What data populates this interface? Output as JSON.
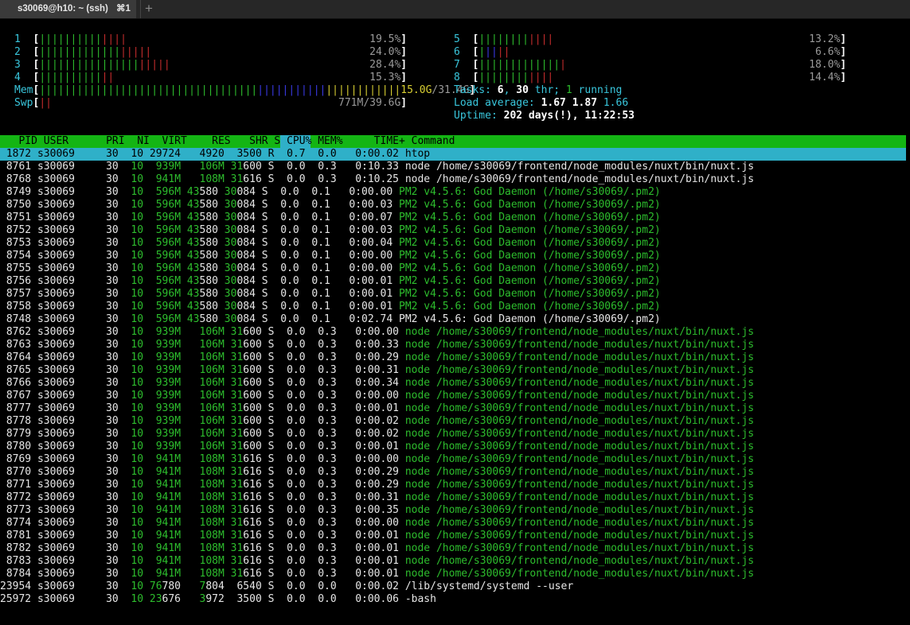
{
  "window": {
    "tab_title": "s30069@h10: ~ (ssh)",
    "tab_shortcut": "⌘1",
    "new_tab_label": "+"
  },
  "colors": {
    "background": "#000000",
    "header_bar": "#14b514",
    "selected_row": "#2fb0c8",
    "meter_green": "#2dbd2d",
    "meter_red": "#c42c2c",
    "meter_blue": "#3a3ae6",
    "meter_yellow": "#d8cf32",
    "label_cyan": "#39c6dc"
  },
  "cpu_meters": [
    {
      "id": "1",
      "percent": "19.5%",
      "green_bars": 10,
      "red_bars": 4
    },
    {
      "id": "2",
      "percent": "24.0%",
      "green_bars": 13,
      "red_bars": 5
    },
    {
      "id": "3",
      "percent": "28.4%",
      "green_bars": 16,
      "red_bars": 5
    },
    {
      "id": "4",
      "percent": "15.3%",
      "green_bars": 10,
      "red_bars": 2
    },
    {
      "id": "5",
      "percent": "13.2%",
      "green_bars": 8,
      "red_bars": 4
    },
    {
      "id": "6",
      "percent": "6.6%",
      "green_bars": 1,
      "blue_bars": 2,
      "red_bars": 2
    },
    {
      "id": "7",
      "percent": "18.0%",
      "green_bars": 13,
      "red_bars": 1
    },
    {
      "id": "8",
      "percent": "14.4%",
      "green_bars": 8,
      "red_bars": 4
    }
  ],
  "mem": {
    "label": "Mem",
    "used": "15.0G",
    "total": "31.4G",
    "green_bars": 35,
    "blue_bars": 11,
    "yellow_bars": 12
  },
  "swap": {
    "label": "Swp",
    "used": "771M",
    "total": "39.6G",
    "red_bars": 2
  },
  "tasks": {
    "label": "Tasks: ",
    "count": "6",
    "sep": ", ",
    "threads": "30",
    "thr_label": " thr; ",
    "running": "1",
    "running_label": " running"
  },
  "load": {
    "label": "Load average: ",
    "one": "1.67",
    "five": "1.87",
    "fifteen": "1.66"
  },
  "uptime": {
    "label": "Uptime: ",
    "value": "202 days(!), 11:22:53"
  },
  "columns": [
    "PID",
    "USER",
    "PRI",
    "NI",
    "VIRT",
    "RES",
    "SHR",
    "S",
    "CPU%",
    "MEM%",
    "TIME+",
    "Command"
  ],
  "processes": [
    {
      "pid": "1872",
      "user": "s30069",
      "pri": "30",
      "ni": "10",
      "virt": "29724",
      "res": "4920",
      "shr": "3500",
      "s": "R",
      "cpu": "0.7",
      "mem": "0.0",
      "time": "0:00.02",
      "cmd": "htop",
      "thread": false,
      "selected": true
    },
    {
      "pid": "8761",
      "user": "s30069",
      "pri": "30",
      "ni": "10",
      "virt": "939M",
      "res": "106M",
      "shr": "31600",
      "s": "S",
      "cpu": "0.0",
      "mem": "0.3",
      "time": "0:10.33",
      "cmd": "node /home/s30069/frontend/node_modules/nuxt/bin/nuxt.js",
      "thread": false
    },
    {
      "pid": "8768",
      "user": "s30069",
      "pri": "30",
      "ni": "10",
      "virt": "941M",
      "res": "108M",
      "shr": "31616",
      "s": "S",
      "cpu": "0.0",
      "mem": "0.3",
      "time": "0:10.25",
      "cmd": "node /home/s30069/frontend/node_modules/nuxt/bin/nuxt.js",
      "thread": false
    },
    {
      "pid": "8749",
      "user": "s30069",
      "pri": "30",
      "ni": "10",
      "virt": "596M",
      "res": "43580",
      "shr": "30084",
      "s": "S",
      "cpu": "0.0",
      "mem": "0.1",
      "time": "0:00.00",
      "cmd": "PM2 v4.5.6: God Daemon (/home/s30069/.pm2)",
      "thread": true
    },
    {
      "pid": "8750",
      "user": "s30069",
      "pri": "30",
      "ni": "10",
      "virt": "596M",
      "res": "43580",
      "shr": "30084",
      "s": "S",
      "cpu": "0.0",
      "mem": "0.1",
      "time": "0:00.03",
      "cmd": "PM2 v4.5.6: God Daemon (/home/s30069/.pm2)",
      "thread": true
    },
    {
      "pid": "8751",
      "user": "s30069",
      "pri": "30",
      "ni": "10",
      "virt": "596M",
      "res": "43580",
      "shr": "30084",
      "s": "S",
      "cpu": "0.0",
      "mem": "0.1",
      "time": "0:00.07",
      "cmd": "PM2 v4.5.6: God Daemon (/home/s30069/.pm2)",
      "thread": true
    },
    {
      "pid": "8752",
      "user": "s30069",
      "pri": "30",
      "ni": "10",
      "virt": "596M",
      "res": "43580",
      "shr": "30084",
      "s": "S",
      "cpu": "0.0",
      "mem": "0.1",
      "time": "0:00.03",
      "cmd": "PM2 v4.5.6: God Daemon (/home/s30069/.pm2)",
      "thread": true
    },
    {
      "pid": "8753",
      "user": "s30069",
      "pri": "30",
      "ni": "10",
      "virt": "596M",
      "res": "43580",
      "shr": "30084",
      "s": "S",
      "cpu": "0.0",
      "mem": "0.1",
      "time": "0:00.04",
      "cmd": "PM2 v4.5.6: God Daemon (/home/s30069/.pm2)",
      "thread": true
    },
    {
      "pid": "8754",
      "user": "s30069",
      "pri": "30",
      "ni": "10",
      "virt": "596M",
      "res": "43580",
      "shr": "30084",
      "s": "S",
      "cpu": "0.0",
      "mem": "0.1",
      "time": "0:00.00",
      "cmd": "PM2 v4.5.6: God Daemon (/home/s30069/.pm2)",
      "thread": true
    },
    {
      "pid": "8755",
      "user": "s30069",
      "pri": "30",
      "ni": "10",
      "virt": "596M",
      "res": "43580",
      "shr": "30084",
      "s": "S",
      "cpu": "0.0",
      "mem": "0.1",
      "time": "0:00.00",
      "cmd": "PM2 v4.5.6: God Daemon (/home/s30069/.pm2)",
      "thread": true
    },
    {
      "pid": "8756",
      "user": "s30069",
      "pri": "30",
      "ni": "10",
      "virt": "596M",
      "res": "43580",
      "shr": "30084",
      "s": "S",
      "cpu": "0.0",
      "mem": "0.1",
      "time": "0:00.01",
      "cmd": "PM2 v4.5.6: God Daemon (/home/s30069/.pm2)",
      "thread": true
    },
    {
      "pid": "8757",
      "user": "s30069",
      "pri": "30",
      "ni": "10",
      "virt": "596M",
      "res": "43580",
      "shr": "30084",
      "s": "S",
      "cpu": "0.0",
      "mem": "0.1",
      "time": "0:00.01",
      "cmd": "PM2 v4.5.6: God Daemon (/home/s30069/.pm2)",
      "thread": true
    },
    {
      "pid": "8758",
      "user": "s30069",
      "pri": "30",
      "ni": "10",
      "virt": "596M",
      "res": "43580",
      "shr": "30084",
      "s": "S",
      "cpu": "0.0",
      "mem": "0.1",
      "time": "0:00.01",
      "cmd": "PM2 v4.5.6: God Daemon (/home/s30069/.pm2)",
      "thread": true
    },
    {
      "pid": "8748",
      "user": "s30069",
      "pri": "30",
      "ni": "10",
      "virt": "596M",
      "res": "43580",
      "shr": "30084",
      "s": "S",
      "cpu": "0.0",
      "mem": "0.1",
      "time": "0:02.74",
      "cmd": "PM2 v4.5.6: God Daemon (/home/s30069/.pm2)",
      "thread": false
    },
    {
      "pid": "8762",
      "user": "s30069",
      "pri": "30",
      "ni": "10",
      "virt": "939M",
      "res": "106M",
      "shr": "31600",
      "s": "S",
      "cpu": "0.0",
      "mem": "0.3",
      "time": "0:00.00",
      "cmd": "node /home/s30069/frontend/node_modules/nuxt/bin/nuxt.js",
      "thread": true
    },
    {
      "pid": "8763",
      "user": "s30069",
      "pri": "30",
      "ni": "10",
      "virt": "939M",
      "res": "106M",
      "shr": "31600",
      "s": "S",
      "cpu": "0.0",
      "mem": "0.3",
      "time": "0:00.33",
      "cmd": "node /home/s30069/frontend/node_modules/nuxt/bin/nuxt.js",
      "thread": true
    },
    {
      "pid": "8764",
      "user": "s30069",
      "pri": "30",
      "ni": "10",
      "virt": "939M",
      "res": "106M",
      "shr": "31600",
      "s": "S",
      "cpu": "0.0",
      "mem": "0.3",
      "time": "0:00.29",
      "cmd": "node /home/s30069/frontend/node_modules/nuxt/bin/nuxt.js",
      "thread": true
    },
    {
      "pid": "8765",
      "user": "s30069",
      "pri": "30",
      "ni": "10",
      "virt": "939M",
      "res": "106M",
      "shr": "31600",
      "s": "S",
      "cpu": "0.0",
      "mem": "0.3",
      "time": "0:00.31",
      "cmd": "node /home/s30069/frontend/node_modules/nuxt/bin/nuxt.js",
      "thread": true
    },
    {
      "pid": "8766",
      "user": "s30069",
      "pri": "30",
      "ni": "10",
      "virt": "939M",
      "res": "106M",
      "shr": "31600",
      "s": "S",
      "cpu": "0.0",
      "mem": "0.3",
      "time": "0:00.34",
      "cmd": "node /home/s30069/frontend/node_modules/nuxt/bin/nuxt.js",
      "thread": true
    },
    {
      "pid": "8767",
      "user": "s30069",
      "pri": "30",
      "ni": "10",
      "virt": "939M",
      "res": "106M",
      "shr": "31600",
      "s": "S",
      "cpu": "0.0",
      "mem": "0.3",
      "time": "0:00.00",
      "cmd": "node /home/s30069/frontend/node_modules/nuxt/bin/nuxt.js",
      "thread": true
    },
    {
      "pid": "8777",
      "user": "s30069",
      "pri": "30",
      "ni": "10",
      "virt": "939M",
      "res": "106M",
      "shr": "31600",
      "s": "S",
      "cpu": "0.0",
      "mem": "0.3",
      "time": "0:00.01",
      "cmd": "node /home/s30069/frontend/node_modules/nuxt/bin/nuxt.js",
      "thread": true
    },
    {
      "pid": "8778",
      "user": "s30069",
      "pri": "30",
      "ni": "10",
      "virt": "939M",
      "res": "106M",
      "shr": "31600",
      "s": "S",
      "cpu": "0.0",
      "mem": "0.3",
      "time": "0:00.02",
      "cmd": "node /home/s30069/frontend/node_modules/nuxt/bin/nuxt.js",
      "thread": true
    },
    {
      "pid": "8779",
      "user": "s30069",
      "pri": "30",
      "ni": "10",
      "virt": "939M",
      "res": "106M",
      "shr": "31600",
      "s": "S",
      "cpu": "0.0",
      "mem": "0.3",
      "time": "0:00.02",
      "cmd": "node /home/s30069/frontend/node_modules/nuxt/bin/nuxt.js",
      "thread": true
    },
    {
      "pid": "8780",
      "user": "s30069",
      "pri": "30",
      "ni": "10",
      "virt": "939M",
      "res": "106M",
      "shr": "31600",
      "s": "S",
      "cpu": "0.0",
      "mem": "0.3",
      "time": "0:00.01",
      "cmd": "node /home/s30069/frontend/node_modules/nuxt/bin/nuxt.js",
      "thread": true
    },
    {
      "pid": "8769",
      "user": "s30069",
      "pri": "30",
      "ni": "10",
      "virt": "941M",
      "res": "108M",
      "shr": "31616",
      "s": "S",
      "cpu": "0.0",
      "mem": "0.3",
      "time": "0:00.00",
      "cmd": "node /home/s30069/frontend/node_modules/nuxt/bin/nuxt.js",
      "thread": true
    },
    {
      "pid": "8770",
      "user": "s30069",
      "pri": "30",
      "ni": "10",
      "virt": "941M",
      "res": "108M",
      "shr": "31616",
      "s": "S",
      "cpu": "0.0",
      "mem": "0.3",
      "time": "0:00.29",
      "cmd": "node /home/s30069/frontend/node_modules/nuxt/bin/nuxt.js",
      "thread": true
    },
    {
      "pid": "8771",
      "user": "s30069",
      "pri": "30",
      "ni": "10",
      "virt": "941M",
      "res": "108M",
      "shr": "31616",
      "s": "S",
      "cpu": "0.0",
      "mem": "0.3",
      "time": "0:00.29",
      "cmd": "node /home/s30069/frontend/node_modules/nuxt/bin/nuxt.js",
      "thread": true
    },
    {
      "pid": "8772",
      "user": "s30069",
      "pri": "30",
      "ni": "10",
      "virt": "941M",
      "res": "108M",
      "shr": "31616",
      "s": "S",
      "cpu": "0.0",
      "mem": "0.3",
      "time": "0:00.31",
      "cmd": "node /home/s30069/frontend/node_modules/nuxt/bin/nuxt.js",
      "thread": true
    },
    {
      "pid": "8773",
      "user": "s30069",
      "pri": "30",
      "ni": "10",
      "virt": "941M",
      "res": "108M",
      "shr": "31616",
      "s": "S",
      "cpu": "0.0",
      "mem": "0.3",
      "time": "0:00.35",
      "cmd": "node /home/s30069/frontend/node_modules/nuxt/bin/nuxt.js",
      "thread": true
    },
    {
      "pid": "8774",
      "user": "s30069",
      "pri": "30",
      "ni": "10",
      "virt": "941M",
      "res": "108M",
      "shr": "31616",
      "s": "S",
      "cpu": "0.0",
      "mem": "0.3",
      "time": "0:00.00",
      "cmd": "node /home/s30069/frontend/node_modules/nuxt/bin/nuxt.js",
      "thread": true
    },
    {
      "pid": "8781",
      "user": "s30069",
      "pri": "30",
      "ni": "10",
      "virt": "941M",
      "res": "108M",
      "shr": "31616",
      "s": "S",
      "cpu": "0.0",
      "mem": "0.3",
      "time": "0:00.01",
      "cmd": "node /home/s30069/frontend/node_modules/nuxt/bin/nuxt.js",
      "thread": true
    },
    {
      "pid": "8782",
      "user": "s30069",
      "pri": "30",
      "ni": "10",
      "virt": "941M",
      "res": "108M",
      "shr": "31616",
      "s": "S",
      "cpu": "0.0",
      "mem": "0.3",
      "time": "0:00.01",
      "cmd": "node /home/s30069/frontend/node_modules/nuxt/bin/nuxt.js",
      "thread": true
    },
    {
      "pid": "8783",
      "user": "s30069",
      "pri": "30",
      "ni": "10",
      "virt": "941M",
      "res": "108M",
      "shr": "31616",
      "s": "S",
      "cpu": "0.0",
      "mem": "0.3",
      "time": "0:00.01",
      "cmd": "node /home/s30069/frontend/node_modules/nuxt/bin/nuxt.js",
      "thread": true
    },
    {
      "pid": "8784",
      "user": "s30069",
      "pri": "30",
      "ni": "10",
      "virt": "941M",
      "res": "108M",
      "shr": "31616",
      "s": "S",
      "cpu": "0.0",
      "mem": "0.3",
      "time": "0:00.01",
      "cmd": "node /home/s30069/frontend/node_modules/nuxt/bin/nuxt.js",
      "thread": true
    },
    {
      "pid": "23954",
      "user": "s30069",
      "pri": "30",
      "ni": "10",
      "virt": "76780",
      "res": "7804",
      "shr": "6540",
      "s": "S",
      "cpu": "0.0",
      "mem": "0.0",
      "time": "0:00.02",
      "cmd": "/lib/systemd/systemd --user",
      "thread": false
    },
    {
      "pid": "25972",
      "user": "s30069",
      "pri": "30",
      "ni": "10",
      "virt": "23676",
      "res": "3972",
      "shr": "3500",
      "s": "S",
      "cpu": "0.0",
      "mem": "0.0",
      "time": "0:00.06",
      "cmd": "-bash",
      "thread": false
    }
  ]
}
